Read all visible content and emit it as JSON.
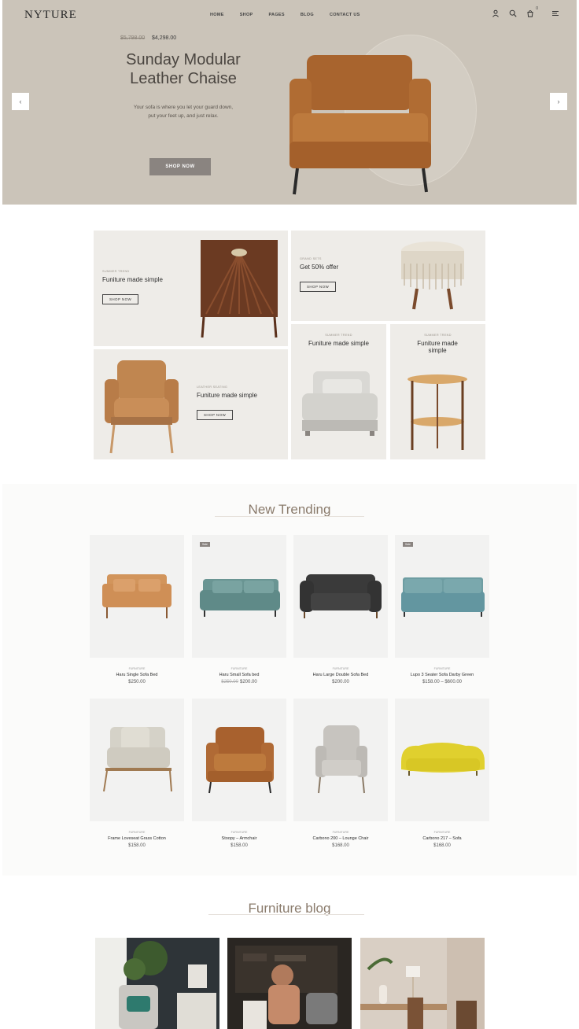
{
  "header": {
    "logo": "NYTURE",
    "nav": [
      "HOME",
      "SHOP",
      "PAGES",
      "BLOG",
      "CONTACT US"
    ],
    "cart_count": "0",
    "icons": [
      "user-icon",
      "search-icon",
      "cart-icon",
      "menu-icon"
    ]
  },
  "hero": {
    "price_old": "$5,798.00",
    "price_new": "$4,298.00",
    "title_line1": "Sunday Modular",
    "title_line2": "Leather Chaise",
    "subtitle_line1": "Your sofa is where you let your guard down,",
    "subtitle_line2": "put your feet up, and just relax.",
    "button": "SHOP NOW",
    "prev_arrow": "‹",
    "next_arrow": "›"
  },
  "categories": [
    {
      "small": "SUMMER TREND",
      "title": "Funiture made simple",
      "button": "SHOP NOW"
    },
    {
      "small": "GRAND SETS",
      "title": "Get 50% offer",
      "button": "SHOP NOW"
    },
    {
      "small": "LEATHER SEATING",
      "title": "Funiture made simple",
      "button": "SHOP NOW"
    },
    {
      "small": "SUMMER TREND",
      "title": "Funiture made simple"
    },
    {
      "small": "SUMMER TREND",
      "title": "Funiture made simple"
    }
  ],
  "trending": {
    "title": "New Trending",
    "products": [
      {
        "category": "FURNITURE",
        "name": "Haru Single Sofa Bed",
        "price": "$250.00",
        "old_price": ""
      },
      {
        "category": "FURNITURE",
        "name": "Haru Small Sofa bed",
        "price": "$200.00",
        "old_price": "$250.00",
        "badge": "Sale"
      },
      {
        "category": "FURNITURE",
        "name": "Haru Large Double Sofa Bed",
        "price": "$200.00",
        "old_price": ""
      },
      {
        "category": "FURNITURE",
        "name": "Lupo 3 Seater Sofa Darby Green",
        "price": "$158.00 – $600.00",
        "old_price": "",
        "badge": "Sale"
      },
      {
        "category": "FURNITURE",
        "name": "Frame Loveseat Grass Cotton",
        "price": "$158.00",
        "old_price": ""
      },
      {
        "category": "FURNITURE",
        "name": "Stoopy – Armchair",
        "price": "$158.00",
        "old_price": ""
      },
      {
        "category": "FURNITURE",
        "name": "Carbono 200 – Lounge Chair",
        "price": "$168.00",
        "old_price": ""
      },
      {
        "category": "FURNITURE",
        "name": "Carbono 217 – Sofa",
        "price": "$168.00",
        "old_price": ""
      }
    ]
  },
  "blog": {
    "title": "Furniture blog"
  },
  "colors": {
    "hero_bg": "#cbc4b9",
    "accent": "#8a7b6c",
    "button": "#8a8480",
    "tile_bg": "#eeece8"
  }
}
